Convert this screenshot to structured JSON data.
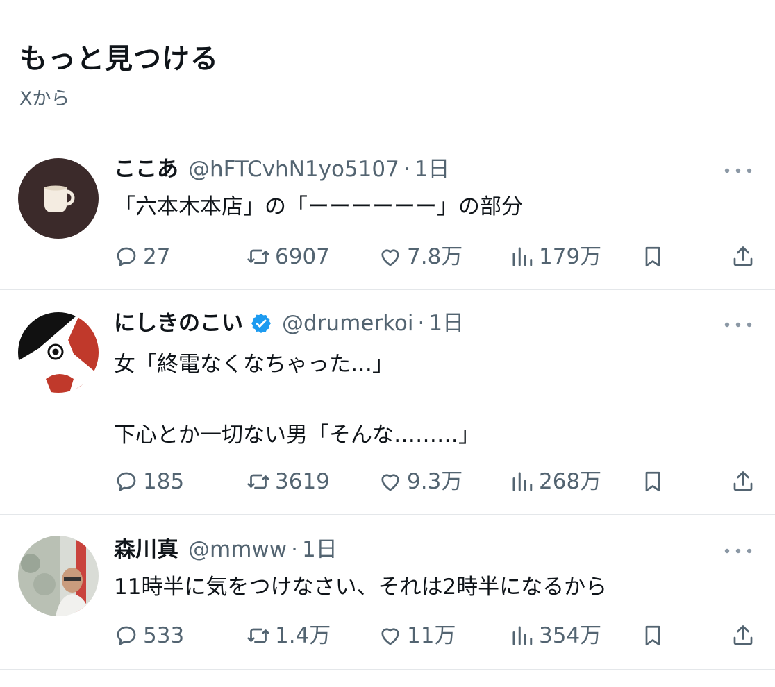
{
  "section": {
    "title": "もっと見つける",
    "subtitle": "Xから"
  },
  "colors": {
    "text": "#0f1419",
    "muted": "#536471",
    "verified": "#1d9bf0",
    "divider": "#e4e7ea"
  },
  "posts": [
    {
      "name": "ここあ",
      "handle": "@hFTCvhN1yo5107",
      "time": "1日",
      "verified": false,
      "avatar": "coffee-mug-avatar",
      "text": "「六本木本店」の「ーーーーーー」の部分",
      "replies": "27",
      "reposts": "6907",
      "likes": "7.8万",
      "views": "179万"
    },
    {
      "name": "にしきのこい",
      "handle": "@drumerkoi",
      "time": "1日",
      "verified": true,
      "avatar": "koi-fish-avatar",
      "text": "女「終電なくなちゃった…」\n\n下心とか一切ない男「そんな………」",
      "replies": "185",
      "reposts": "3619",
      "likes": "9.3万",
      "views": "268万"
    },
    {
      "name": "森川真",
      "handle": "@mmww",
      "time": "1日",
      "verified": false,
      "avatar": "person-photo-avatar",
      "text": "11時半に気をつけなさい、それは2時半になるから",
      "replies": "533",
      "reposts": "1.4万",
      "likes": "11万",
      "views": "354万"
    }
  ]
}
